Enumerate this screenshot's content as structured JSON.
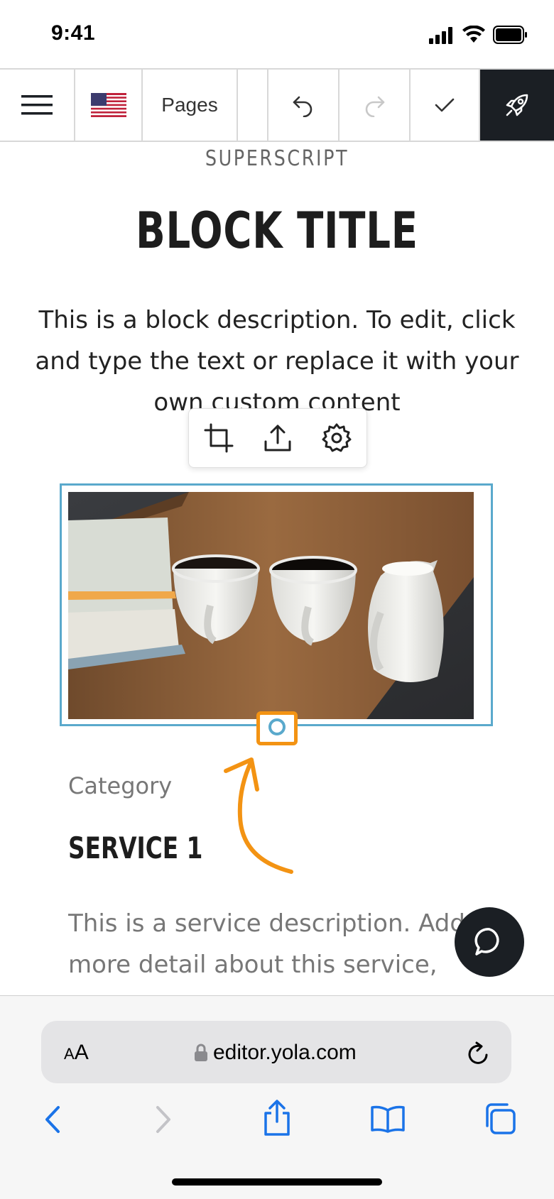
{
  "status_bar": {
    "time": "9:41"
  },
  "toolbar": {
    "pages_label": "Pages",
    "menu_icon": "hamburger-menu-icon",
    "flag_icon": "us-flag-icon",
    "undo_icon": "undo-icon",
    "redo_icon": "redo-icon",
    "check_icon": "check-icon",
    "publish_icon": "rocket-icon"
  },
  "content": {
    "superscript": "SUPERSCRIPT",
    "block_title": "BLOCK TITLE",
    "block_description": "This is a block description. To edit, click and type the text or replace it with your own custom content",
    "image_toolbar": [
      "crop-icon",
      "upload-icon",
      "gear-icon"
    ],
    "category": "Category",
    "service_title": "SERVICE 1",
    "service_description": "This is a service description. Add more detail about this service, such as..."
  },
  "browser": {
    "aa_label": "AA",
    "url": "editor.yola.com",
    "nav_icons": [
      "back-icon",
      "forward-icon",
      "share-icon",
      "bookmarks-icon",
      "tabs-icon"
    ]
  },
  "colors": {
    "accent_blue": "#5aa9cc",
    "highlight_orange": "#f39313",
    "dark": "#1b1f24",
    "ios_blue": "#1a73e8"
  }
}
